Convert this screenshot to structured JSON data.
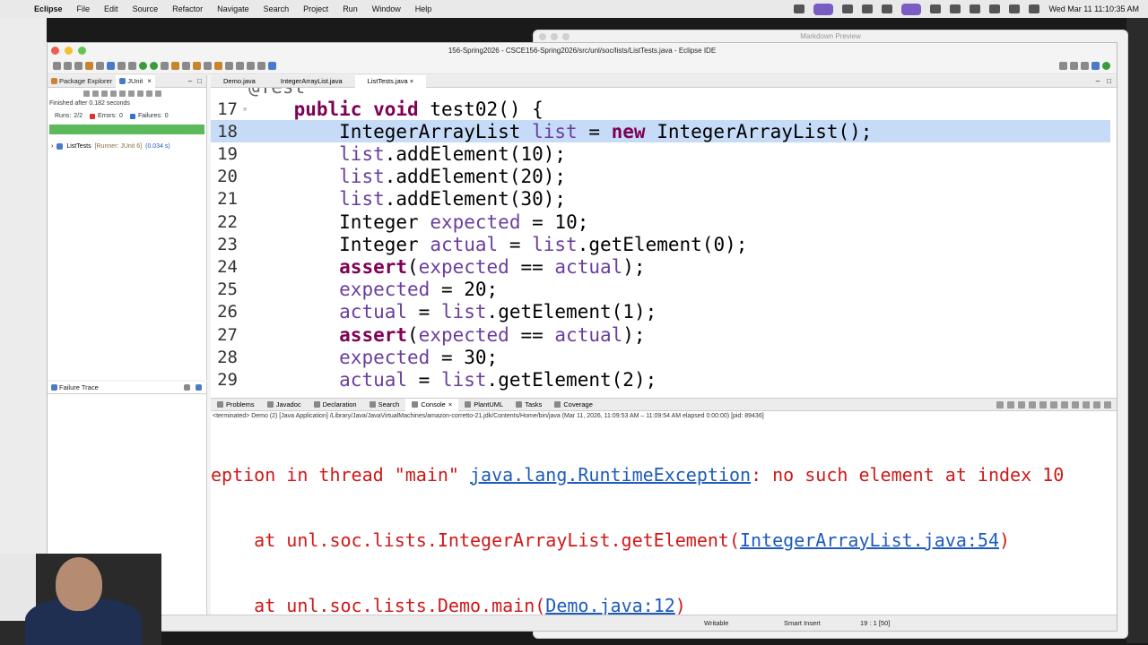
{
  "menubar": {
    "app": "Eclipse",
    "items": [
      "File",
      "Edit",
      "Source",
      "Refactor",
      "Navigate",
      "Search",
      "Project",
      "Run",
      "Window",
      "Help"
    ],
    "clock": "Wed Mar 11  11:10:35 AM"
  },
  "markdown_window": {
    "title": "Markdown Preview"
  },
  "window": {
    "title": "156-Spring2026 - CSCE156-Spring2026/src/unl/soc/lists/ListTests.java - Eclipse IDE"
  },
  "left_panel": {
    "tabs": [
      "Package Explorer",
      "JUnit"
    ],
    "finished": "Finished after 0.182 seconds",
    "runs_label": "Runs:",
    "runs_value": "2/2",
    "errors_label": "Errors:",
    "errors_value": "0",
    "failures_label": "Failures:",
    "failures_value": "0",
    "tree_item": "ListTests",
    "tree_runner": "[Runner: JUnit 6]",
    "tree_time": "(0.034 s)",
    "failure_trace_label": "Failure Trace"
  },
  "editor": {
    "tabs": [
      "Demo.java",
      "IntegerArrayList.java",
      "ListTests.java"
    ],
    "active_tab": "ListTests.java",
    "partial_top_line": "@Test",
    "lines": [
      {
        "num": "17",
        "text": "    public void test02() {"
      },
      {
        "num": "18",
        "text": "        IntegerArrayList list = new IntegerArrayList();"
      },
      {
        "num": "19",
        "text": "        list.addElement(10);"
      },
      {
        "num": "20",
        "text": "        list.addElement(20);"
      },
      {
        "num": "21",
        "text": "        list.addElement(30);"
      },
      {
        "num": "22",
        "text": "        Integer expected = 10;"
      },
      {
        "num": "23",
        "text": "        Integer actual = list.getElement(0);"
      },
      {
        "num": "24",
        "text": "        assert(expected == actual);"
      },
      {
        "num": "25",
        "text": "        expected = 20;"
      },
      {
        "num": "26",
        "text": "        actual = list.getElement(1);"
      },
      {
        "num": "27",
        "text": "        assert(expected == actual);"
      },
      {
        "num": "28",
        "text": "        expected = 30;"
      },
      {
        "num": "29",
        "text": "        actual = list.getElement(2);"
      }
    ]
  },
  "console": {
    "tabs": [
      "Problems",
      "Javadoc",
      "Declaration",
      "Search",
      "Console",
      "PlantUML",
      "Tasks",
      "Coverage"
    ],
    "active_tab": "Console",
    "status": "<terminated> Demo (2) [Java Application] /Library/Java/JavaVirtualMachines/amazon-corretto-21.jdk/Contents/Home/bin/java  (Mar 11, 2026, 11:09:53 AM – 11:09:54 AM elapsed 0:00:00) [pid: 89436]",
    "line1_pre": "eption in thread \"main\" ",
    "line1_link": "java.lang.RuntimeException",
    "line1_post": ": no such element at index 10",
    "line2_pre": "    at unl.soc.lists.IntegerArrayList.getElement(",
    "line2_link": "IntegerArrayList.java:54",
    "line2_post": ")",
    "line3_pre": "    at unl.soc.lists.Demo.main(",
    "line3_link": "Demo.java:12",
    "line3_post": ")"
  },
  "statusbar": {
    "writable": "Writable",
    "insert": "Smart Insert",
    "position": "19 : 1 [50]"
  },
  "colors": {
    "keyword": "#7f0055",
    "field": "#6a3e9e",
    "highlight": "#c6dbf7",
    "error": "#d01818",
    "link": "#1e5bbd",
    "junit_bar": "#5cb95c"
  }
}
